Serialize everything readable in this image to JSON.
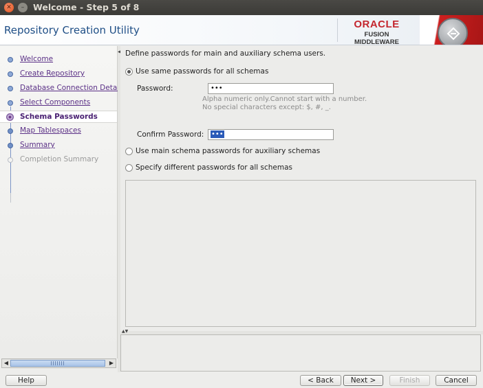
{
  "window": {
    "title": "Welcome - Step 5 of 8"
  },
  "header": {
    "app_title": "Repository Creation Utility",
    "logo_brand": "ORACLE",
    "logo_product": "FUSION MIDDLEWARE"
  },
  "nav": {
    "items": [
      {
        "label": "Welcome",
        "state": "done"
      },
      {
        "label": "Create Repository",
        "state": "done"
      },
      {
        "label": "Database Connection Details",
        "state": "done"
      },
      {
        "label": "Select Components",
        "state": "done"
      },
      {
        "label": "Schema Passwords",
        "state": "current"
      },
      {
        "label": "Map Tablespaces",
        "state": "todo"
      },
      {
        "label": "Summary",
        "state": "todo"
      },
      {
        "label": "Completion Summary",
        "state": "pending"
      }
    ]
  },
  "main": {
    "intro": "Define passwords for main and auxiliary schema users.",
    "option_same": "Use same passwords for all schemas",
    "option_main": "Use main schema passwords for auxiliary schemas",
    "option_different": "Specify different passwords for all schemas",
    "selected_option": "same",
    "password_label": "Password:",
    "password_value": "•••",
    "hint_line1": "Alpha numeric only.Cannot start with a number.",
    "hint_line2": "No special characters except: $, #, _.",
    "confirm_label": "Confirm Password:",
    "confirm_value": "•••"
  },
  "footer": {
    "help": "Help",
    "back": "< Back",
    "next": "Next >",
    "finish": "Finish",
    "cancel": "Cancel"
  },
  "colors": {
    "accent": "#1e4e86",
    "nav_link": "#5a2f86",
    "oracle_red": "#c4262e"
  }
}
